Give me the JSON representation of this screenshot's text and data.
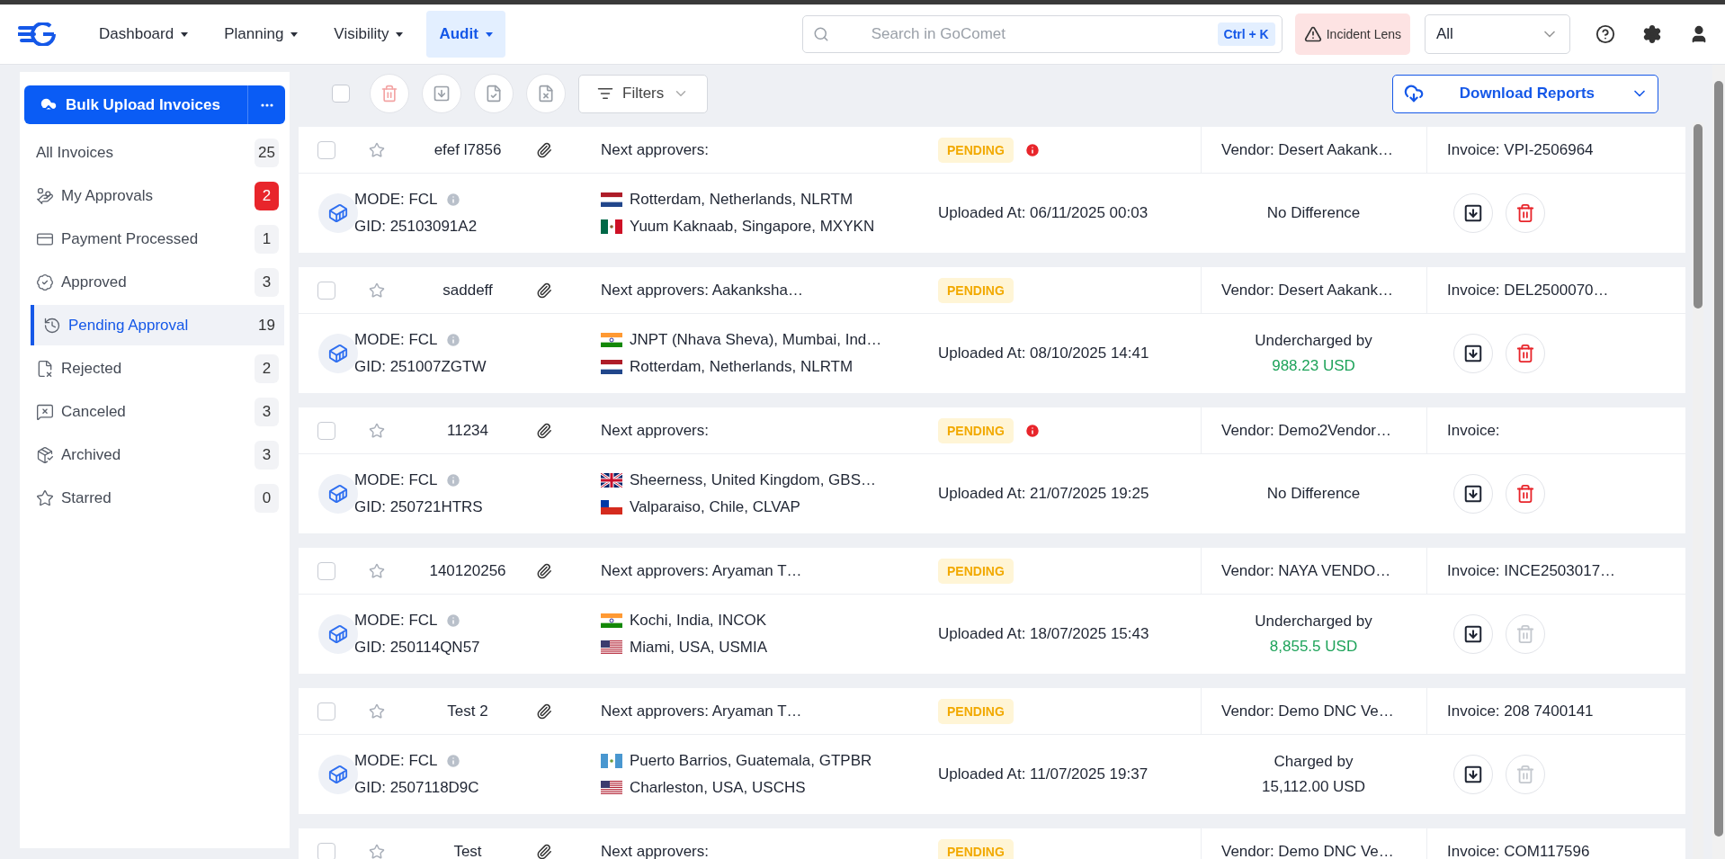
{
  "topbar": {
    "nav": [
      {
        "label": "Dashboard",
        "selected": false
      },
      {
        "label": "Planning",
        "selected": false
      },
      {
        "label": "Visibility",
        "selected": false
      },
      {
        "label": "Audit",
        "selected": true
      }
    ],
    "search": {
      "placeholder": "Search in GoComet",
      "shortcut": "Ctrl + K"
    },
    "incident_button": "Incident Lens",
    "scope_select": "All"
  },
  "sidebar": {
    "upload_button": "Bulk Upload Invoices",
    "items": [
      {
        "kind": "all",
        "label": "All Invoices",
        "count": "25",
        "alert": false,
        "selected": false
      },
      {
        "kind": "approvals",
        "label": "My Approvals",
        "count": "2",
        "alert": true,
        "selected": false
      },
      {
        "kind": "payment",
        "label": "Payment Processed",
        "count": "1",
        "alert": false,
        "selected": false
      },
      {
        "kind": "approved",
        "label": "Approved",
        "count": "3",
        "alert": false,
        "selected": false
      },
      {
        "kind": "pending",
        "label": "Pending Approval",
        "count": "19",
        "alert": false,
        "selected": true
      },
      {
        "kind": "rejected",
        "label": "Rejected",
        "count": "2",
        "alert": false,
        "selected": false
      },
      {
        "kind": "canceled",
        "label": "Canceled",
        "count": "3",
        "alert": false,
        "selected": false
      },
      {
        "kind": "archived",
        "label": "Archived",
        "count": "3",
        "alert": false,
        "selected": false
      },
      {
        "kind": "starred",
        "label": "Starred",
        "count": "0",
        "alert": false,
        "selected": false
      }
    ]
  },
  "toolbar": {
    "select_all_checked": false,
    "filters": "Filters",
    "download_button": "Download Reports"
  },
  "invoices": [
    {
      "checked": false,
      "name": "efef l7856",
      "approvers": "Next approvers:",
      "status": "PENDING",
      "alert": true,
      "vendor": "Vendor: Desert Aakank…",
      "invoice": "Invoice: VPI-2506964",
      "mode": "MODE: FCL",
      "gid": "GID: 25103091A2",
      "origin": {
        "kind": "nl",
        "place": "Rotterdam, Netherlands, NLRTM"
      },
      "destination": {
        "kind": "mx",
        "place": "Yuum Kaknaab, Singapore, MXYKN"
      },
      "uploaded": "Uploaded At: 06/11/2025 00:03",
      "difference": {
        "kind": "none",
        "label": "No Difference"
      },
      "delete_enabled": true
    },
    {
      "checked": false,
      "name": "saddeff",
      "approvers": "Next approvers: Aakanksha…",
      "status": "PENDING",
      "alert": false,
      "vendor": "Vendor: Desert Aakank…",
      "invoice": "Invoice: DEL2500070…",
      "mode": "MODE: FCL",
      "gid": "GID: 251007ZGTW",
      "origin": {
        "kind": "in",
        "place": "JNPT (Nhava Sheva), Mumbai, Ind…"
      },
      "destination": {
        "kind": "nl",
        "place": "Rotterdam, Netherlands, NLRTM"
      },
      "uploaded": "Uploaded At: 08/10/2025 14:41",
      "difference": {
        "kind": "under",
        "label": "Undercharged by",
        "amount": "988.23 USD"
      },
      "delete_enabled": true
    },
    {
      "checked": false,
      "name": "11234",
      "approvers": "Next approvers:",
      "status": "PENDING",
      "alert": true,
      "vendor": "Vendor: Demo2Vendor…",
      "invoice": "Invoice:",
      "mode": "MODE: FCL",
      "gid": "GID: 250721HTRS",
      "origin": {
        "kind": "gb",
        "place": "Sheerness, United Kingdom, GBS…"
      },
      "destination": {
        "kind": "cl",
        "place": "Valparaiso, Chile, CLVAP"
      },
      "uploaded": "Uploaded At: 21/07/2025 19:25",
      "difference": {
        "kind": "none",
        "label": "No Difference"
      },
      "delete_enabled": true
    },
    {
      "checked": false,
      "name": "140120256",
      "approvers": "Next approvers: Aryaman T…",
      "status": "PENDING",
      "alert": false,
      "vendor": "Vendor: NAYA VENDO…",
      "invoice": "Invoice: INCE2503017…",
      "mode": "MODE: FCL",
      "gid": "GID: 250114QN57",
      "origin": {
        "kind": "in",
        "place": "Kochi, India, INCOK"
      },
      "destination": {
        "kind": "us",
        "place": "Miami, USA, USMIA"
      },
      "uploaded": "Uploaded At: 18/07/2025 15:43",
      "difference": {
        "kind": "under",
        "label": "Undercharged by",
        "amount": "8,855.5 USD"
      },
      "delete_enabled": false
    },
    {
      "checked": false,
      "name": "Test 2",
      "approvers": "Next approvers: Aryaman T…",
      "status": "PENDING",
      "alert": false,
      "vendor": "Vendor: Demo DNC Ve…",
      "invoice": "Invoice: 208 7400141",
      "mode": "MODE: FCL",
      "gid": "GID: 2507118D9C",
      "origin": {
        "kind": "gt",
        "place": "Puerto Barrios, Guatemala, GTPBR"
      },
      "destination": {
        "kind": "us",
        "place": "Charleston, USA, USCHS"
      },
      "uploaded": "Uploaded At: 11/07/2025 19:37",
      "difference": {
        "kind": "charged",
        "label": "Charged by",
        "amount": "15,112.00 USD"
      },
      "delete_enabled": false
    },
    {
      "checked": false,
      "name": "Test",
      "approvers": "Next approvers:",
      "status": "PENDING",
      "alert": false,
      "vendor": "Vendor: Demo DNC Ve…",
      "invoice": "Invoice: COM117596"
    }
  ]
}
